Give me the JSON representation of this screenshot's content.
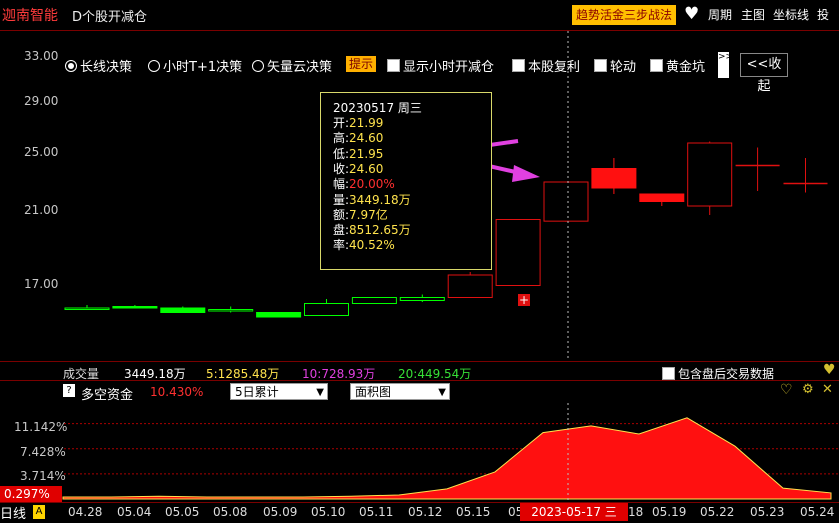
{
  "title": {
    "stock_name": "迦南智能",
    "indicator": "D个股开减仓",
    "strategy_btn": "趋势活金三步战法",
    "period": "周期",
    "main_chart": "主图",
    "coord_line": "坐标线",
    "more": "投"
  },
  "options": {
    "radios": [
      {
        "label": "长线决策",
        "selected": true
      },
      {
        "label": "小时T+1决策",
        "selected": false
      },
      {
        "label": "矢量云决策",
        "selected": false
      }
    ],
    "tip": "提示",
    "checkboxes": [
      "显示小时开减仓",
      "本股复利",
      "轮动",
      "黄金坑"
    ],
    "scroll_glyph": ">>",
    "collapse": "<<收起"
  },
  "y_axis": [
    "33.00",
    "29.00",
    "25.00",
    "21.00",
    "17.00"
  ],
  "info": {
    "date": "20230517",
    "weekday": "周三",
    "rows": [
      {
        "k": "开:",
        "v": "21.99",
        "red": false
      },
      {
        "k": "高:",
        "v": "24.60",
        "red": false
      },
      {
        "k": "低:",
        "v": "21.95",
        "red": false
      },
      {
        "k": "收:",
        "v": "24.60",
        "red": false
      },
      {
        "k": "幅:",
        "v": "20.00%",
        "red": true
      },
      {
        "k": "量:",
        "v": "3449.18万",
        "red": false
      },
      {
        "k": "额:",
        "v": "7.97亿",
        "red": false
      },
      {
        "k": "盘:",
        "v": "8512.65万",
        "red": false
      },
      {
        "k": "率:",
        "v": "40.52%",
        "red": false
      }
    ]
  },
  "volume": {
    "label": "成交量",
    "value": "3449.18万",
    "ma5": "5:1285.48万",
    "ma10": "10:728.93万",
    "ma20": "20:449.54万",
    "after_hours": "包含盘后交易数据"
  },
  "lower_panel": {
    "title": "多空资金",
    "value": "10.430%",
    "select1": "5日累计",
    "select2": "面积图",
    "y_labels": [
      "11.142%",
      "7.428%",
      "3.714%"
    ],
    "current_tag": "0.297%"
  },
  "x_axis": {
    "period": "日线",
    "warn": "A",
    "labels": [
      "04.28",
      "05.04",
      "05.05",
      "05.08",
      "05.09",
      "05.10",
      "05.11",
      "05.12",
      "05.15",
      "05",
      "18",
      "05.19",
      "05.22",
      "05.23",
      "05.24"
    ],
    "selected_date": "2023-05-17 三"
  },
  "chart_data": {
    "type": "candlestick",
    "ylim": [
      15.0,
      33.0
    ],
    "dates": [
      "04.28",
      "05.04",
      "05.05",
      "05.08",
      "05.09",
      "05.10",
      "05.11",
      "05.12",
      "05.15",
      "05.16",
      "05.17",
      "05.18",
      "05.19",
      "05.22",
      "05.23",
      "05.24"
    ],
    "candles": [
      {
        "o": 16.2,
        "h": 16.4,
        "l": 16.1,
        "c": 16.2,
        "color": "green"
      },
      {
        "o": 16.3,
        "h": 16.4,
        "l": 16.2,
        "c": 16.2,
        "color": "green"
      },
      {
        "o": 16.2,
        "h": 16.3,
        "l": 15.9,
        "c": 15.9,
        "color": "green"
      },
      {
        "o": 16.1,
        "h": 16.3,
        "l": 15.9,
        "c": 16.1,
        "color": "green"
      },
      {
        "o": 15.9,
        "h": 15.9,
        "l": 15.6,
        "c": 15.6,
        "color": "green"
      },
      {
        "o": 15.7,
        "h": 16.8,
        "l": 15.7,
        "c": 16.5,
        "color": "green"
      },
      {
        "o": 16.5,
        "h": 16.9,
        "l": 16.6,
        "c": 16.9,
        "color": "green"
      },
      {
        "o": 16.7,
        "h": 17.1,
        "l": 16.6,
        "c": 16.9,
        "color": "green"
      },
      {
        "o": 16.9,
        "h": 18.6,
        "l": 16.9,
        "c": 18.4,
        "color": "red-hollow"
      },
      {
        "o": 17.7,
        "h": 22.0,
        "l": 17.7,
        "c": 22.1,
        "color": "red-hollow"
      },
      {
        "o": 21.99,
        "h": 24.6,
        "l": 21.95,
        "c": 24.6,
        "color": "red-hollow"
      },
      {
        "o": 25.5,
        "h": 26.2,
        "l": 23.8,
        "c": 24.2,
        "color": "red-solid"
      },
      {
        "o": 23.8,
        "h": 23.8,
        "l": 23.0,
        "c": 23.3,
        "color": "red-solid"
      },
      {
        "o": 23.0,
        "h": 27.3,
        "l": 22.4,
        "c": 27.2,
        "color": "red-hollow"
      },
      {
        "o": 25.8,
        "h": 26.9,
        "l": 24.0,
        "c": 25.7,
        "color": "red-cross"
      },
      {
        "o": 24.7,
        "h": 26.2,
        "l": 23.9,
        "c": 24.5,
        "color": "red-cross"
      }
    ],
    "money_flow": [
      0.3,
      0.3,
      0.4,
      0.3,
      0.3,
      0.3,
      0.4,
      0.6,
      1.5,
      4.0,
      9.8,
      10.8,
      9.6,
      12.0,
      7.8,
      1.6,
      0.9
    ],
    "money_ylim": [
      0,
      13.0
    ]
  }
}
